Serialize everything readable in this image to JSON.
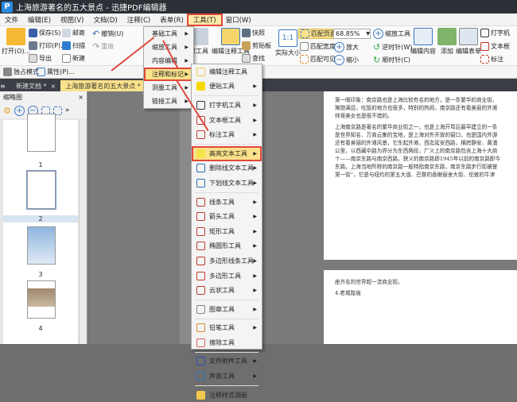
{
  "window": {
    "title": "上海旅游著名的五大景点 - 迅捷PDF编辑器",
    "logo": "P"
  },
  "menubar": [
    "文件",
    "编辑(E)",
    "视图(V)",
    "文档(D)",
    "注释(C)",
    "表单(R)",
    "工具(T)",
    "窗口(W)"
  ],
  "ribbon": {
    "open": "打开(O)...",
    "save": "保存(S)",
    "print": "打印(P)...",
    "export": "导出",
    "mail": "邮寄",
    "scan": "扫描",
    "new": "新建",
    "undo": "撤销(U)",
    "redo": "重做",
    "select": "取工具",
    "edit_annot": "编辑注释工具",
    "snapshot": "快照",
    "clipboard": "剪贴板",
    "find": "查找",
    "actual": "实际大小",
    "fit_page": "匹配页面",
    "fit_width": "匹配宽度",
    "fit_visible": "匹配可见",
    "zoom_value": "68.85%",
    "zoom_in": "放大",
    "zoom_out": "缩小",
    "zoom_tool": "缩放工具",
    "ccw": "逆时针(W)",
    "cw": "顺时针(C)",
    "edit_content": "编辑内容",
    "add": "添加",
    "edit_form": "编辑表单",
    "typewriter": "打字机",
    "textbox": "文本框",
    "callout": "标注"
  },
  "row2": {
    "exclusive": "独占模式",
    "properties": "属性(P)..."
  },
  "tabs": [
    "新建文档 *",
    "上海旅游著名的五大景点 *"
  ],
  "thumbnails": {
    "title": "缩略图",
    "pages": [
      "1",
      "2",
      "3",
      "4"
    ]
  },
  "tools_menu": [
    {
      "label": "基础工具"
    },
    {
      "label": "缩放工具"
    },
    {
      "label": "内容编辑"
    },
    {
      "label": "注释和标记",
      "highlighted": true
    },
    {
      "label": "测量工具"
    },
    {
      "label": "链接工具"
    }
  ],
  "annot_menu": [
    {
      "label": "编辑注释工具",
      "icon": "edit-annotation-icon",
      "color": "#f2c94c",
      "sub": false
    },
    {
      "label": "便贴工具",
      "icon": "sticky-note-icon",
      "color": "#f5d800",
      "sub": true,
      "sep": true
    },
    {
      "label": "打字机工具",
      "icon": "typewriter-icon",
      "color": "#333",
      "sub": true
    },
    {
      "label": "文本框工具",
      "icon": "textbox-icon",
      "color": "#c0392b",
      "sub": true
    },
    {
      "label": "标注工具",
      "icon": "callout-icon",
      "color": "#c0392b",
      "sub": true,
      "sep": true
    },
    {
      "label": "高亮文本工具",
      "icon": "highlight-text-icon",
      "color": "#f7e34a",
      "sub": true,
      "highlighted": true
    },
    {
      "label": "删除线文本工具",
      "icon": "strikeout-icon",
      "color": "#2e6db4",
      "sub": true
    },
    {
      "label": "下划线文本工具",
      "icon": "underline-icon",
      "color": "#2e6db4",
      "sub": true,
      "sep": true
    },
    {
      "label": "线条工具",
      "icon": "line-icon",
      "color": "#c0392b",
      "sub": true
    },
    {
      "label": "箭头工具",
      "icon": "arrow-icon",
      "color": "#c0392b",
      "sub": true
    },
    {
      "label": "矩形工具",
      "icon": "rectangle-icon",
      "color": "#c0392b",
      "sub": true
    },
    {
      "label": "椭圆形工具",
      "icon": "ellipse-icon",
      "color": "#c0392b",
      "sub": true
    },
    {
      "label": "多边形线条工具",
      "icon": "polyline-icon",
      "color": "#c0392b",
      "sub": true
    },
    {
      "label": "多边形工具",
      "icon": "polygon-icon",
      "color": "#c0392b",
      "sub": true
    },
    {
      "label": "云状工具",
      "icon": "cloud-icon",
      "color": "#c0392b",
      "sub": true,
      "sep": true
    },
    {
      "label": "图章工具",
      "icon": "stamp-icon",
      "color": "#7a8a7a",
      "sub": true,
      "sep": true
    },
    {
      "label": "铅笔工具",
      "icon": "pencil-icon",
      "color": "#e08a2c",
      "sub": true
    },
    {
      "label": "擦除工具",
      "icon": "eraser-icon",
      "color": "#e06060",
      "sub": false,
      "sep": true
    },
    {
      "label": "文件附件工具",
      "icon": "attachment-icon",
      "color": "#2e4fb4",
      "sub": true
    },
    {
      "label": "声音工具",
      "icon": "sound-icon",
      "color": "#2e6db4",
      "sub": true,
      "sep": true
    },
    {
      "label": "注释样式调板",
      "icon": "style-palette-icon",
      "color": "#f2c94c",
      "sub": false
    }
  ],
  "document": {
    "page1": [
      "第一眼印象：南京路也是上海比较有名的地方，是一条繁华的商业街，",
      "琳琅满目，吃饭的地方也很多，特别的热闹，南京路还有看美丽的外滩",
      "帅哥美女也是很不错的。",
      "",
      "上海南京路是著名的繁华商业街之一，也是上海开埠后最早建立的一条",
      "是世界知名、万商云集的宝地，是上海对外开放的窗口，也是国内外游",
      "还有看美丽的外滩风景，它东起外滩，西迄延安西路，横跨静安、黄浦",
      "公里，以西藏中路为界分为东西两段，广义上的南京路包含上海十大商",
      "个——南京东路与南京西路，狭义的南京路即1945年以前的南京路即今",
      "东路，上海当地所称的南京路一般特指南京东路，南京东路步行街被誉",
      "第一街”，它是与纽约的第五大道、巴黎的香榭丽舍大街、伦敦的牛津"
    ],
    "page2": [
      "座齐名的世界超一流商业街。",
      "4.老城隍庙"
    ]
  }
}
